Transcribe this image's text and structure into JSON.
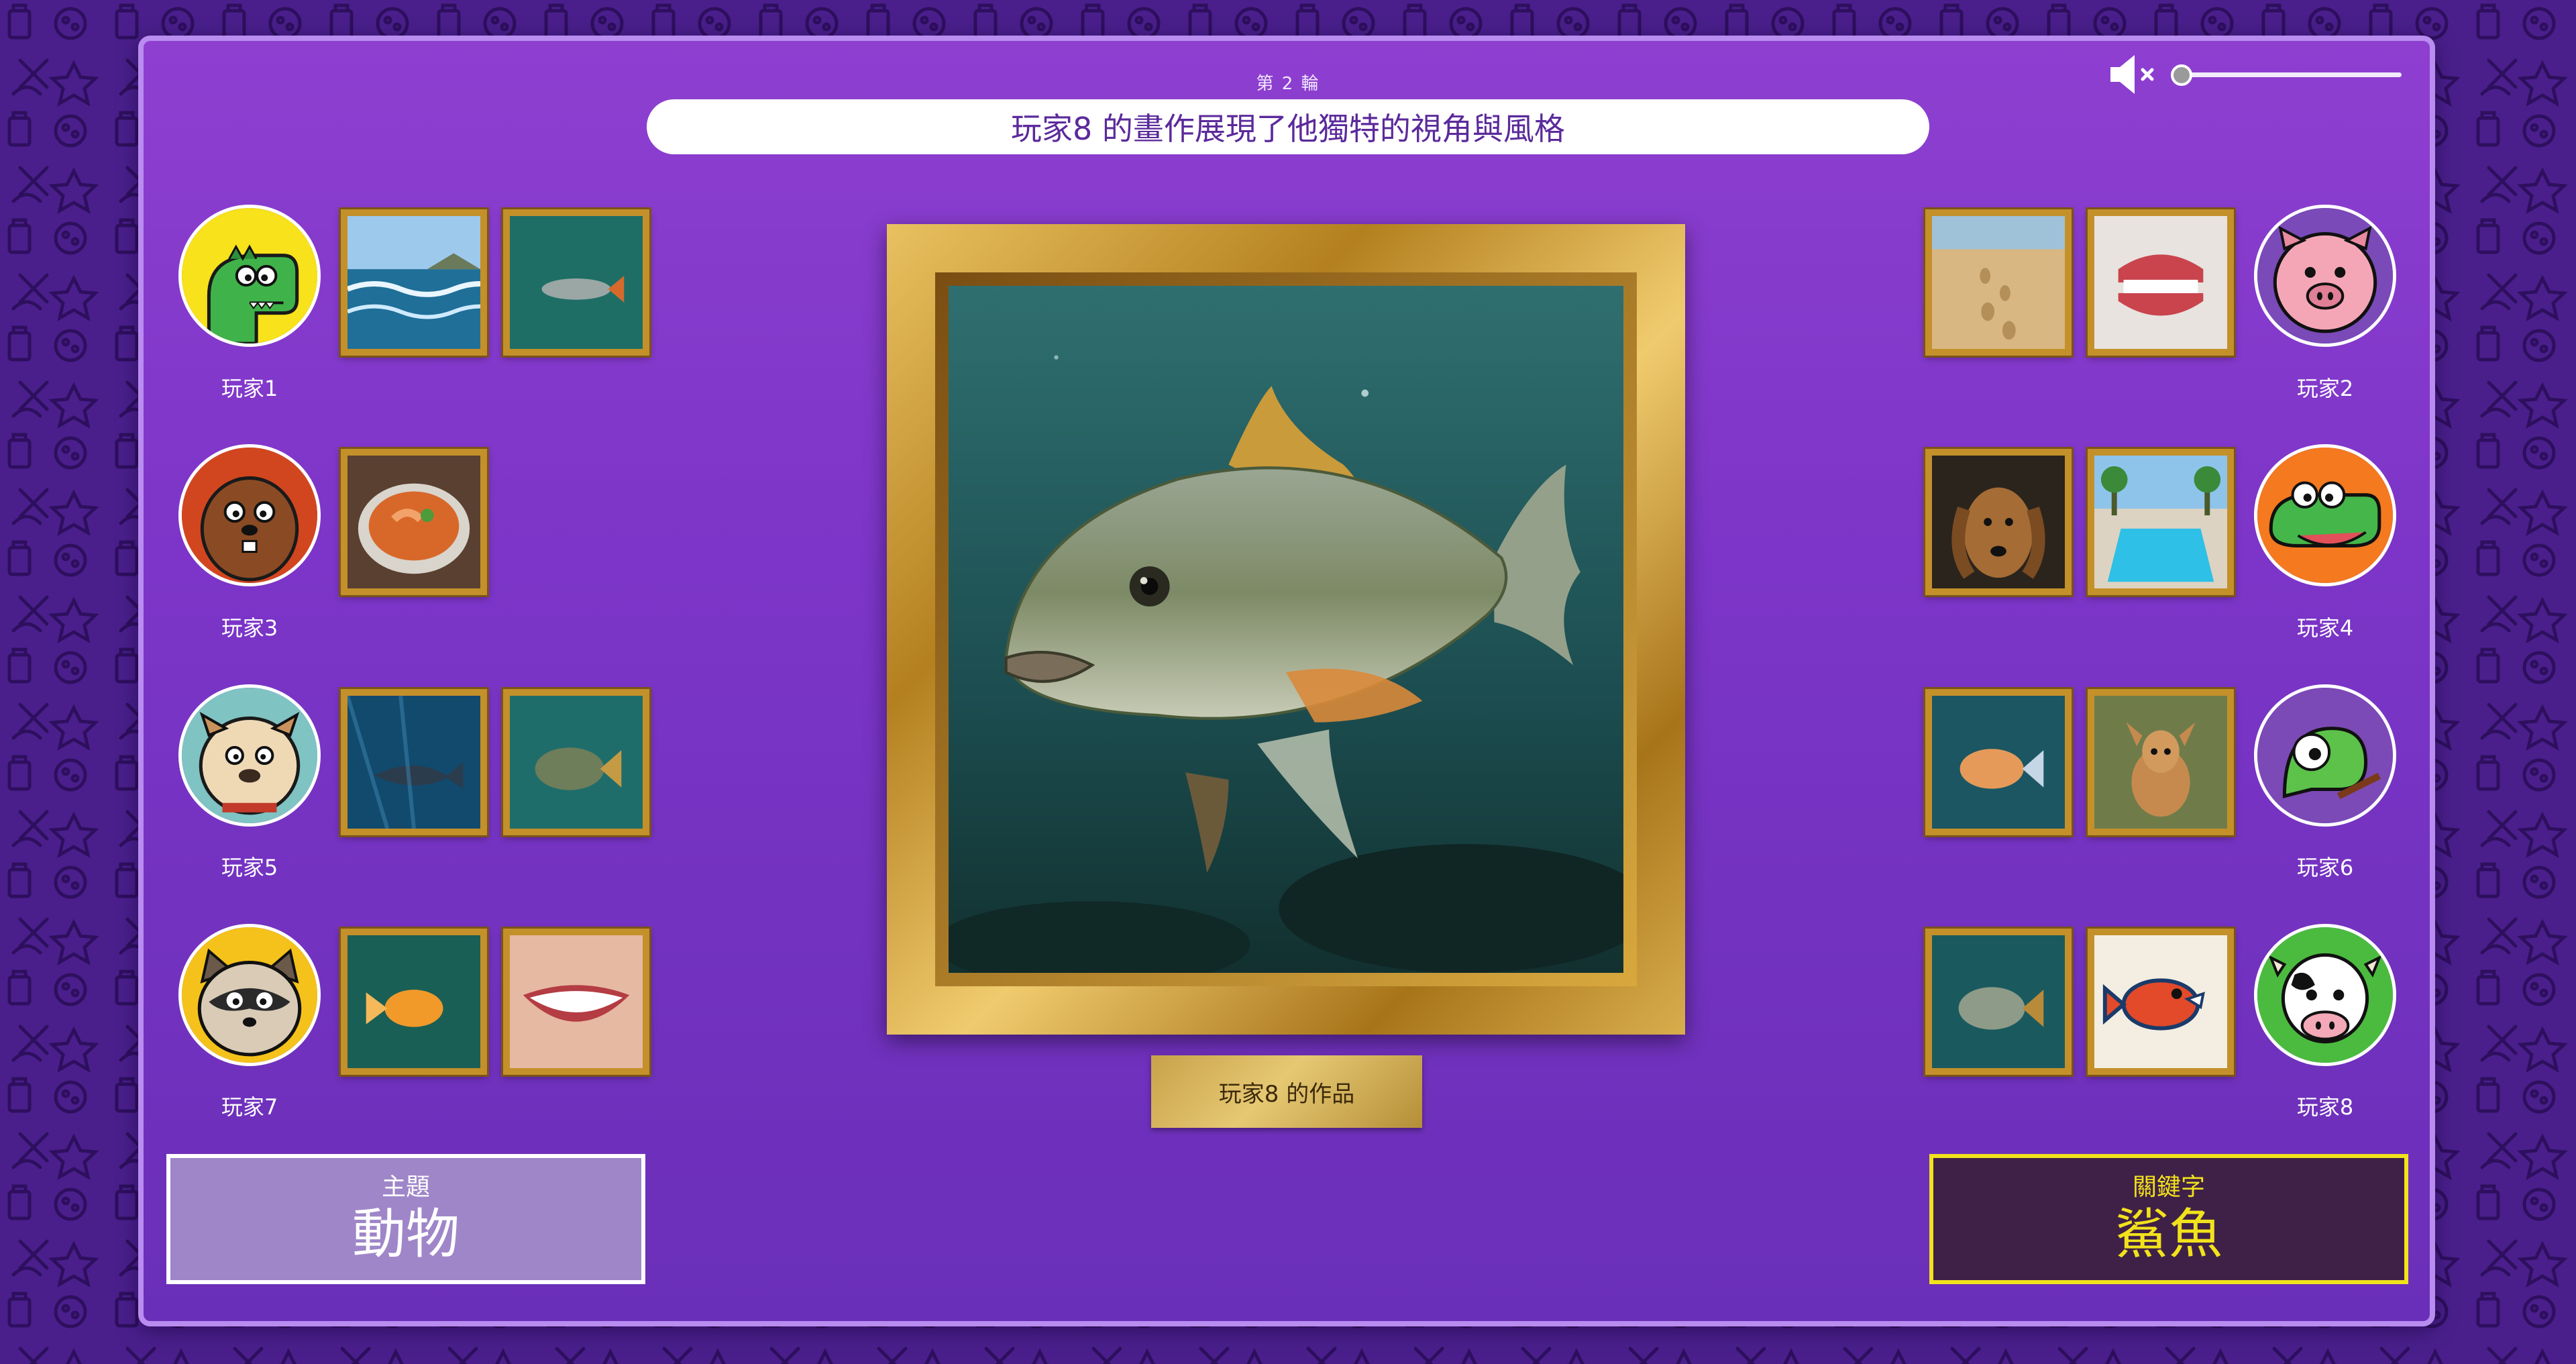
{
  "round": {
    "label": "第 2 輪"
  },
  "banner": {
    "text": "玩家8 的畫作展現了他獨特的視角與風格"
  },
  "volume": {
    "icon": "volume-muted-icon",
    "level": 0
  },
  "players": [
    {
      "name": "玩家1",
      "avatar": "dinosaur",
      "thumbs": [
        "ocean-waves",
        "underwater-fish"
      ]
    },
    {
      "name": "玩家3",
      "avatar": "beaver",
      "thumbs": [
        "shrimp-soup"
      ]
    },
    {
      "name": "玩家5",
      "avatar": "bulldog",
      "thumbs": [
        "shark-underwater",
        "fish-underwater"
      ]
    },
    {
      "name": "玩家7",
      "avatar": "raccoon",
      "thumbs": [
        "goldfish",
        "smiling-teeth"
      ]
    },
    {
      "name": "玩家2",
      "avatar": "pig",
      "thumbs": [
        "beach-footprints",
        "dentures"
      ]
    },
    {
      "name": "玩家4",
      "avatar": "crocodile",
      "thumbs": [
        "dog-portrait",
        "pool-resort"
      ]
    },
    {
      "name": "玩家6",
      "avatar": "chameleon",
      "thumbs": [
        "tropical-fish",
        "baby-deer"
      ]
    },
    {
      "name": "玩家8",
      "avatar": "cow",
      "thumbs": [
        "piranha-fish",
        "cartoon-fish"
      ]
    }
  ],
  "featured": {
    "image": "fish-underwater-painting",
    "caption": "玩家8 的作品"
  },
  "theme": {
    "label": "主題",
    "value": "動物"
  },
  "keyword": {
    "label": "關鍵字",
    "value": "鯊魚"
  },
  "colors": {
    "panel": "#7c35c8",
    "banner_text": "#5b2a9b",
    "keyword": "#f2e21c",
    "frame_gold": "#c4902a"
  }
}
